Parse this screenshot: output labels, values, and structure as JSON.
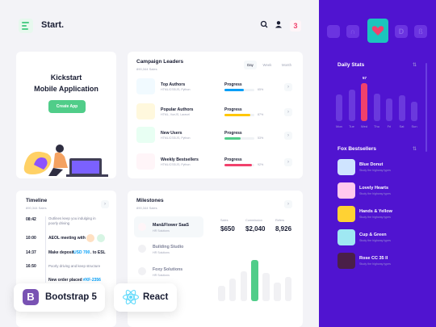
{
  "header": {
    "brand": "Start.",
    "notif_count": "3"
  },
  "kickstart": {
    "title": "Kickstart\nMobile Application",
    "button": "Create App"
  },
  "campaign": {
    "title": "Campaign Leaders",
    "subtitle": "890,344 Sales",
    "tabs": [
      "Day",
      "Week",
      "Month"
    ],
    "rows": [
      {
        "name": "Top Authors",
        "sub": "HTML/CSS/JS, Python",
        "progress_label": "Progress",
        "value": "65%",
        "fraction": 0.65,
        "color": "#009ef7",
        "icon_bg": "#f1faff"
      },
      {
        "name": "Popular Authors",
        "sub": "HTML, VueJS, Laravel",
        "progress_label": "Progress",
        "value": "87%",
        "fraction": 0.87,
        "color": "#ffc700",
        "icon_bg": "#fff8dd"
      },
      {
        "name": "New Users",
        "sub": "HTML/CSS/JS, Python",
        "progress_label": "Progress",
        "value": "53%",
        "fraction": 0.53,
        "color": "#50cd89",
        "icon_bg": "#e8fff3"
      },
      {
        "name": "Weekly Bestsellers",
        "sub": "HTML/CSS/JS, Python",
        "progress_label": "Progress",
        "value": "92%",
        "fraction": 0.92,
        "color": "#f1416c",
        "icon_bg": "#fff5f8"
      }
    ]
  },
  "timeline": {
    "title": "Timeline",
    "subtitle": "890,344 Sales",
    "items": [
      {
        "time": "08:42",
        "text": "Outlines keep you indulging in\npoorly driving",
        "bold": false
      },
      {
        "time": "10:00",
        "text": "AEOL meeting with",
        "bold": true
      },
      {
        "time": "14:37",
        "text": "Make deposit",
        "bold": true,
        "tag": "USD 700",
        "tag_rest": ". to ESL"
      },
      {
        "time": "16:50",
        "text": "Poorly driving and keep structure",
        "bold": false
      },
      {
        "time": "",
        "text": "New order placed",
        "bold": true,
        "tag": "#XF-2356"
      }
    ]
  },
  "milestones": {
    "title": "Milestones",
    "subtitle": "890,344 Sales",
    "items": [
      {
        "name": "Man&Flower SaaS",
        "sub": "HR Solutions"
      },
      {
        "name": "Building Studio",
        "sub": "HR Solutions"
      },
      {
        "name": "Foxy Solutions",
        "sub": "HR Solutions"
      }
    ],
    "stats": [
      {
        "label": "Sales",
        "value": "$650"
      },
      {
        "label": "Commission",
        "value": "$2,040"
      },
      {
        "label": "Refers",
        "value": "8,926"
      }
    ],
    "bars": [
      0.38,
      0.55,
      0.72,
      1.0,
      0.68,
      0.45,
      0.58
    ],
    "highlight_bar": 3
  },
  "badges": {
    "bootstrap": "Bootstrap 5",
    "react": "React"
  },
  "daily": {
    "title": "Daily Stats",
    "peak_value": "57",
    "days": [
      "Mon",
      "Tue",
      "Wed",
      "Thu",
      "Fri",
      "Sat",
      "Sun"
    ],
    "bars": [
      0.7,
      0.82,
      1.0,
      0.72,
      0.6,
      0.68,
      0.52
    ],
    "highlight": 2
  },
  "fox": {
    "title": "Fox Bestsellers",
    "items": [
      {
        "name": "Blue Donut",
        "sub": "Study the highway types",
        "color": "#cfe4ff"
      },
      {
        "name": "Lovely Hearts",
        "sub": "Study the highway types",
        "color": "#ffc9ee"
      },
      {
        "name": "Hands & Yellow",
        "sub": "Study the highway types",
        "color": "#ffd233"
      },
      {
        "name": "Cup & Green",
        "sub": "Study the highway types",
        "color": "#9fe8f2"
      },
      {
        "name": "Rose CC 35 II",
        "sub": "Study the highway types",
        "color": "#4a1f48"
      }
    ]
  },
  "colors": {
    "accent": "#50cd89",
    "panel": "#5014d0",
    "danger": "#f1416c",
    "primary": "#009ef7"
  }
}
